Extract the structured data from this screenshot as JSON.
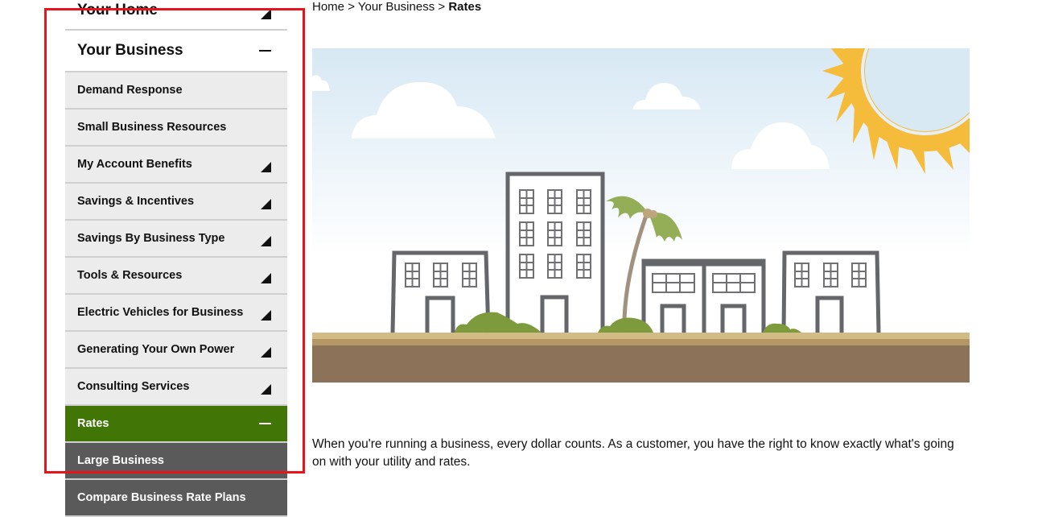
{
  "sidebar": {
    "top_items": [
      {
        "label": "Your Home",
        "icon": "expand-triangle-icon"
      },
      {
        "label": "Your Business",
        "icon": "collapse-minus-icon",
        "expanded": true
      }
    ],
    "business_items": [
      {
        "label": "Demand Response",
        "has_children": false
      },
      {
        "label": "Small Business Resources",
        "has_children": false
      },
      {
        "label": "My Account Benefits",
        "has_children": true
      },
      {
        "label": "Savings & Incentives",
        "has_children": true
      },
      {
        "label": "Savings By Business Type",
        "has_children": true
      },
      {
        "label": "Tools & Resources",
        "has_children": true
      },
      {
        "label": "Electric Vehicles for Business",
        "has_children": true
      },
      {
        "label": "Generating Your Own Power",
        "has_children": true
      },
      {
        "label": "Consulting Services",
        "has_children": true
      },
      {
        "label": "Rates",
        "active": true,
        "expanded": true
      }
    ],
    "rates_children": [
      {
        "label": "Large Business"
      },
      {
        "label": "Compare Business Rate Plans"
      }
    ]
  },
  "breadcrumb": {
    "items": [
      "Home",
      "Your Business"
    ],
    "separator": ">",
    "current": "Rates"
  },
  "hero": {
    "alt": "Illustration of business buildings with palm tree and sun"
  },
  "intro_text": "When you're running a business, every dollar counts. As a customer, you have the right to know exactly what's going on with your utility and rates.",
  "colors": {
    "active_green": "#417505",
    "child_gray": "#5a5a5a",
    "item_bg": "#ececec",
    "highlight_red": "#e8141a",
    "sun": "#f5bb3a",
    "ground": "#8b7259",
    "bush": "#7d9a3c"
  }
}
